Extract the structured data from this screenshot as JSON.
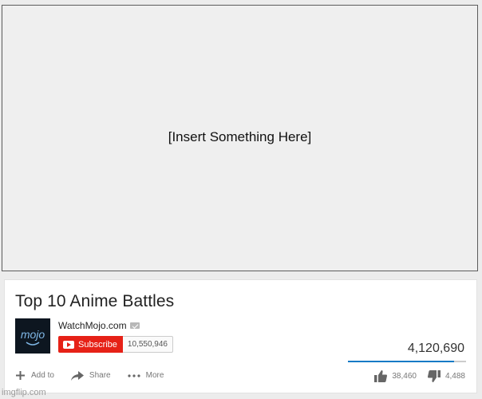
{
  "player": {
    "placeholder": "[Insert Something Here]"
  },
  "video": {
    "title": "Top 10 Anime Battles",
    "views": "4,120,690",
    "like_ratio": 0.9
  },
  "channel": {
    "name": "WatchMojo.com",
    "avatar_logo": "mojo",
    "subscribe_label": "Subscribe",
    "subscriber_count": "10,550,946"
  },
  "actions": {
    "add_to": "Add to",
    "share": "Share",
    "more": "More"
  },
  "ratings": {
    "likes": "38,460",
    "dislikes": "4,488"
  },
  "icons": {
    "add": "plus-icon",
    "share": "share-arrow-icon",
    "more": "more-dots-icon",
    "like": "thumbs-up-icon",
    "dislike": "thumbs-down-icon",
    "verified": "verified-icon"
  },
  "watermark": "imgflip.com",
  "colors": {
    "subscribe_red": "#e62117",
    "like_bar_blue": "#167ac6"
  }
}
